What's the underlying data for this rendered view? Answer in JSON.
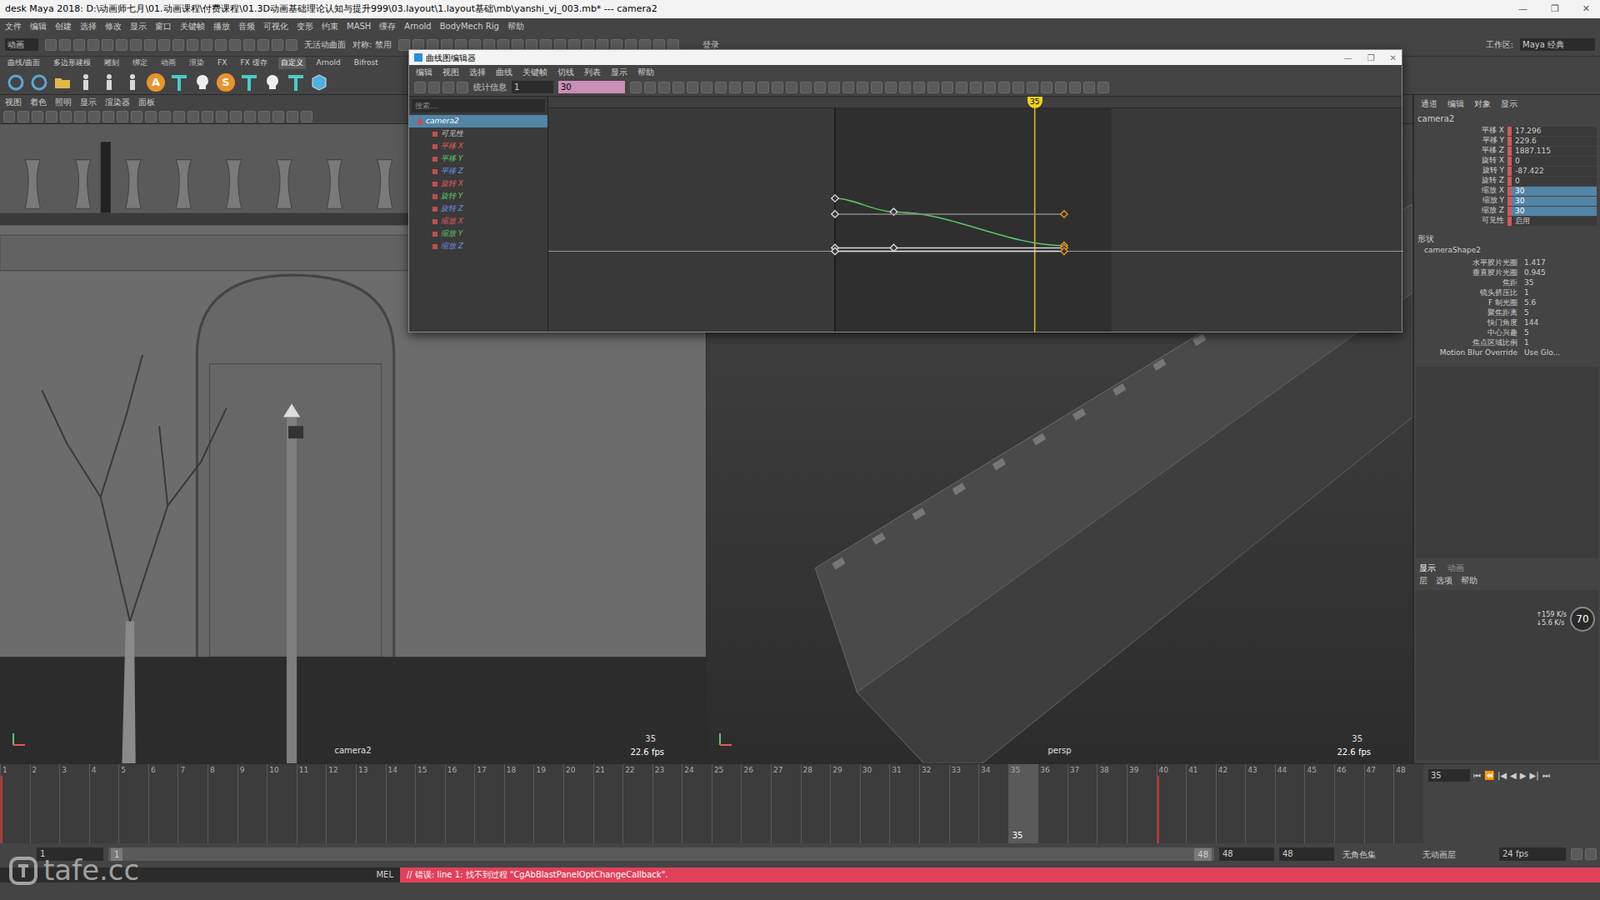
{
  "window": {
    "title": "desk Maya 2018: D:\\动画师七月\\01.动画课程\\付费课程\\01.3D动画基础理论认知与提升999\\03.layout\\1.layout基础\\mb\\yanshi_vj_003.mb*  ---  camera2",
    "controls": [
      "—",
      "❐",
      "✕"
    ]
  },
  "menu_bar": [
    "文件",
    "编辑",
    "创建",
    "选择",
    "修改",
    "显示",
    "窗口",
    "关键帧",
    "播放",
    "音频",
    "可视化",
    "变形",
    "约束",
    "MASH",
    "缓存",
    "Arnold",
    "BodyMech Rig",
    "帮助"
  ],
  "status_line": {
    "mode": "动画",
    "surface": "无活动曲面",
    "symmetry": "对称: 禁用",
    "login": "登录",
    "workspace_label": "工作区:",
    "workspace": "Maya 经典"
  },
  "shelf": {
    "tabs": [
      {
        "label": "曲线/曲面",
        "selected": false
      },
      {
        "label": "多边形建模",
        "selected": false
      },
      {
        "label": "雕刻",
        "selected": false
      },
      {
        "label": "绑定",
        "selected": false
      },
      {
        "label": "动画",
        "selected": false
      },
      {
        "label": "渲染",
        "selected": false
      },
      {
        "label": "FX",
        "selected": false
      },
      {
        "label": "FX 缓存",
        "selected": false
      },
      {
        "label": "自定义",
        "selected": true
      },
      {
        "label": "Arnold",
        "selected": false
      },
      {
        "label": "Bifrost",
        "selected": false
      }
    ],
    "icons": [
      {
        "kind": "ring",
        "text": ""
      },
      {
        "kind": "ring",
        "text": ""
      },
      {
        "kind": "folder",
        "text": ""
      },
      {
        "kind": "man",
        "text": ""
      },
      {
        "kind": "man",
        "text": ""
      },
      {
        "kind": "man",
        "text": ""
      },
      {
        "kind": "letter",
        "text": "A"
      },
      {
        "kind": "tee",
        "text": ""
      },
      {
        "kind": "skull",
        "text": ""
      },
      {
        "kind": "letter",
        "text": "S"
      },
      {
        "kind": "tee",
        "text": ""
      },
      {
        "kind": "skull",
        "text": ""
      },
      {
        "kind": "tee",
        "text": ""
      },
      {
        "kind": "cube",
        "text": ""
      }
    ]
  },
  "viewports": [
    {
      "name": "camera2",
      "menu": [
        "视图",
        "着色",
        "照明",
        "显示",
        "渲染器",
        "面板"
      ],
      "frame": "35",
      "fps": "22.6 fps",
      "scene": "street-front"
    },
    {
      "name": "persp",
      "menu": [
        "视图",
        "着色",
        "照明",
        "显示",
        "渲染器",
        "面板"
      ],
      "frame": "35",
      "fps": "22.6 fps",
      "scene": "street-top"
    }
  ],
  "graph_editor": {
    "title": "曲线图编辑器",
    "menu": [
      "编辑",
      "视图",
      "选择",
      "曲线",
      "关键帧",
      "切线",
      "列表",
      "显示",
      "帮助"
    ],
    "stats_label": "统计信息",
    "stats_value": "1",
    "value_field": "30",
    "search_placeholder": "搜索...",
    "current_frame": 35,
    "current_label": "35",
    "range_start": 1,
    "range_end": 48,
    "zero_line": 0.635,
    "outliner": [
      {
        "label": "camera2",
        "color": "#ffffff",
        "selected": true,
        "indent": false
      },
      {
        "label": "可见性",
        "color": "#c8c8c8",
        "selected": false,
        "indent": true
      },
      {
        "label": "平移 X",
        "color": "#e05a5a",
        "selected": false,
        "indent": true
      },
      {
        "label": "平移 Y",
        "color": "#5fc56a",
        "selected": false,
        "indent": true
      },
      {
        "label": "平移 Z",
        "color": "#6a8fe0",
        "selected": false,
        "indent": true
      },
      {
        "label": "旋转 X",
        "color": "#e05a5a",
        "selected": false,
        "indent": true
      },
      {
        "label": "旋转 Y",
        "color": "#5fc56a",
        "selected": false,
        "indent": true
      },
      {
        "label": "旋转 Z",
        "color": "#6a8fe0",
        "selected": false,
        "indent": true
      },
      {
        "label": "缩放 X",
        "color": "#e05a5a",
        "selected": false,
        "indent": true
      },
      {
        "label": "缩放 Y",
        "color": "#5fc56a",
        "selected": false,
        "indent": true
      },
      {
        "label": "缩放 Z",
        "color": "#6a8fe0",
        "selected": false,
        "indent": true
      }
    ],
    "curves": [
      {
        "color": "#5fc56a",
        "keys": [
          {
            "frame": 1,
            "value": 0.4,
            "selected": false
          },
          {
            "frame": 11,
            "value": 0.46,
            "selected": false
          },
          {
            "frame": 40,
            "value": 0.61,
            "selected": true
          }
        ]
      },
      {
        "color": "#8a8a8a",
        "keys": [
          {
            "frame": 1,
            "value": 0.47,
            "selected": false
          },
          {
            "frame": 40,
            "value": 0.47,
            "selected": true
          }
        ]
      },
      {
        "color": "#d8d8d8",
        "keys": [
          {
            "frame": 1,
            "value": 0.62,
            "selected": false
          },
          {
            "frame": 11,
            "value": 0.62,
            "selected": false
          },
          {
            "frame": 40,
            "value": 0.62,
            "selected": true
          }
        ]
      },
      {
        "color": "#e8e8e8",
        "keys": [
          {
            "frame": 1,
            "value": 0.635,
            "selected": false
          },
          {
            "frame": 40,
            "value": 0.635,
            "selected": true
          }
        ]
      }
    ]
  },
  "channel_box": {
    "menu": [
      "通道",
      "编辑",
      "对象",
      "显示"
    ],
    "object": "camera2",
    "channels": [
      {
        "label": "平移 X",
        "value": "17.296",
        "keyed": true,
        "selected": false
      },
      {
        "label": "平移 Y",
        "value": "229.6",
        "keyed": true,
        "selected": false
      },
      {
        "label": "平移 Z",
        "value": "1887.115",
        "keyed": true,
        "selected": false
      },
      {
        "label": "旋转 X",
        "value": "0",
        "keyed": true,
        "selected": false
      },
      {
        "label": "旋转 Y",
        "value": "-87.422",
        "keyed": true,
        "selected": false
      },
      {
        "label": "旋转 Z",
        "value": "0",
        "keyed": true,
        "selected": false
      },
      {
        "label": "缩放 X",
        "value": "30",
        "keyed": true,
        "selected": true
      },
      {
        "label": "缩放 Y",
        "value": "30",
        "keyed": true,
        "selected": true
      },
      {
        "label": "缩放 Z",
        "value": "30",
        "keyed": true,
        "selected": true
      },
      {
        "label": "可见性",
        "value": "启用",
        "keyed": true,
        "selected": false
      }
    ],
    "shape_heading": "形状",
    "shape": "cameraShape2",
    "shape_attrs": [
      {
        "label": "水平胶片光圈",
        "value": "1.417"
      },
      {
        "label": "垂直胶片光圈",
        "value": "0.945"
      },
      {
        "label": "焦距",
        "value": "35"
      },
      {
        "label": "镜头挤压比",
        "value": "1"
      },
      {
        "label": "F 制光圈",
        "value": "5.6"
      },
      {
        "label": "聚焦距离",
        "value": "5"
      },
      {
        "label": "快门角度",
        "value": "144"
      },
      {
        "label": "中心兴趣",
        "value": "5"
      },
      {
        "label": "焦点区域比例",
        "value": "1"
      },
      {
        "label": "Motion Blur Override",
        "value": "Use Glo..."
      }
    ]
  },
  "layer_editor": {
    "tabs": [
      {
        "label": "显示",
        "selected": true
      },
      {
        "label": "动画",
        "selected": false
      }
    ],
    "menu": [
      "层",
      "选项",
      "帮助"
    ]
  },
  "net_widget": {
    "value": "70",
    "up": "↑159 K/s",
    "down": "↓5.6 K/s"
  },
  "time_slider": {
    "ticks": [
      "1",
      "2",
      "3",
      "4",
      "5",
      "6",
      "7",
      "8",
      "9",
      "10",
      "11",
      "12",
      "13",
      "14",
      "15",
      "16",
      "17",
      "18",
      "19",
      "20",
      "21",
      "22",
      "23",
      "24",
      "25",
      "26",
      "27",
      "28",
      "29",
      "30",
      "31",
      "32",
      "33",
      "34",
      "35",
      "36",
      "37",
      "38",
      "39",
      "40",
      "41",
      "42",
      "43",
      "44",
      "45",
      "46",
      "47",
      "48"
    ],
    "current": "35",
    "key_frames": [
      "1",
      "40"
    ],
    "frame_field": "35",
    "buttons": [
      "⏮",
      "⏪",
      "|◀",
      "◀",
      "▶",
      "▶|",
      "⏭"
    ]
  },
  "range_slider": {
    "start": "1",
    "handle_start": "1",
    "handle_end": "48",
    "end": "48",
    "end2": "48",
    "character_set": "无角色集",
    "anim_layer": "无动画层",
    "fps": "24 fps"
  },
  "command_line": {
    "label": "MEL",
    "error": "// 错误: line 1: 找不到过程 \"CgAbBlastPanelOptChangeCallback\"."
  },
  "watermark": "tafe.cc"
}
